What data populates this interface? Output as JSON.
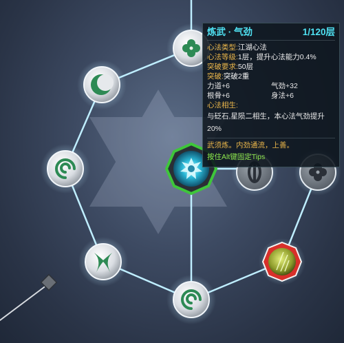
{
  "tooltip": {
    "title": "炼武 · 气劲",
    "level": "1/120层",
    "type_label": "心法类型:",
    "type_value": "江湖心法",
    "grade_label": "心法等级:",
    "grade_value": "1层，提升心法能力0.4%",
    "break_req_label": "突破要求:",
    "break_req_value": "50层",
    "break_label": "突破:",
    "break_value": "突破2重",
    "stats": [
      {
        "name": "力道",
        "value": "+6"
      },
      {
        "name": "气劲",
        "value": "+32"
      },
      {
        "name": "根骨",
        "value": "+6"
      },
      {
        "name": "身法",
        "value": "+6"
      }
    ],
    "synergy_label": "心法相生:",
    "synergy_text": "与砭石,星陨二相生，本心法气劲提升20%",
    "motto": "武须炼。内劲通流，上善。",
    "hint": "按住Alt键固定Tips"
  },
  "nodes": [
    {
      "name": "node-clover",
      "icon": "clover-icon",
      "ring": "silver"
    },
    {
      "name": "node-crescent",
      "icon": "crescent-icon",
      "ring": "silver"
    },
    {
      "name": "node-spiral-left",
      "icon": "spiral-icon",
      "ring": "silver"
    },
    {
      "name": "node-claws",
      "icon": "claws-icon",
      "ring": "silver"
    },
    {
      "name": "node-spiral-bottom",
      "icon": "spiral-icon",
      "ring": "silver"
    },
    {
      "name": "node-crystal",
      "icon": "crystal-icon",
      "ring": "red"
    },
    {
      "name": "node-clover-right",
      "icon": "clover-icon",
      "ring": "dim"
    },
    {
      "name": "node-eye",
      "icon": "eye-icon",
      "ring": "dim"
    },
    {
      "name": "node-center-gear",
      "icon": "gear-icon",
      "ring": "green"
    }
  ],
  "colors": {
    "accent": "#4fe1f2",
    "label": "#e9b54a",
    "hint": "#8ee84f",
    "active_ring": "#3ec63a",
    "warn_ring": "#d8302a"
  }
}
